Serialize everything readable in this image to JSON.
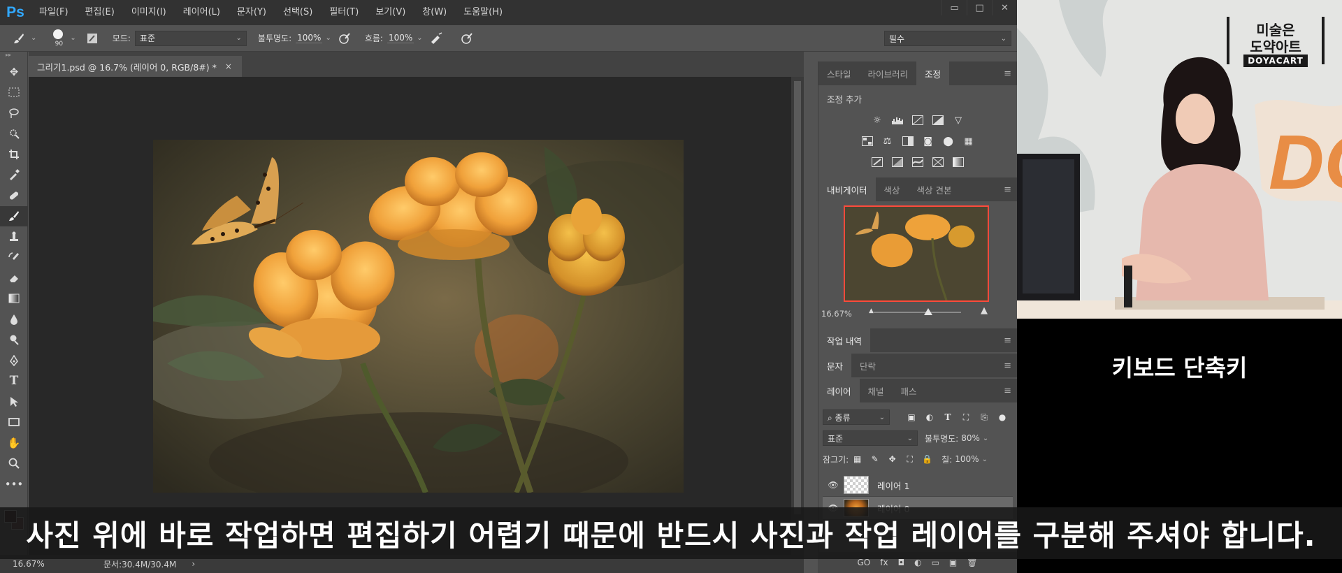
{
  "app": {
    "logo": "Ps",
    "menu": [
      "파일(F)",
      "편집(E)",
      "이미지(I)",
      "레이어(L)",
      "문자(Y)",
      "선택(S)",
      "필터(T)",
      "보기(V)",
      "창(W)",
      "도움말(H)"
    ],
    "window_controls": [
      "▭",
      "□",
      "✕"
    ]
  },
  "options": {
    "brush_size": "90",
    "mode_label": "모드:",
    "mode_value": "표준",
    "opacity_label": "불투명도:",
    "opacity_value": "100%",
    "flow_label": "흐름:",
    "flow_value": "100%",
    "workspace": "필수"
  },
  "document": {
    "tab_title": "그리기1.psd @ 16.7% (레이어 0, RGB/8#) *",
    "close": "×"
  },
  "status": {
    "zoom": "16.67%",
    "doc_size": "문서:30.4M/30.4M",
    "arrow": "›"
  },
  "panels": {
    "top_tabs": [
      "스타일",
      "라이브러리",
      "조정"
    ],
    "adjustments_title": "조정 추가",
    "navigator_tabs": [
      "내비게이터",
      "색상",
      "색상 견본"
    ],
    "navigator_zoom": "16.67%",
    "history_tab": "작업 내역",
    "type_tabs": [
      "문자",
      "단락"
    ],
    "layers_tabs": [
      "레이어",
      "채널",
      "패스"
    ],
    "filter_kind": "종류",
    "blend_mode": "표준",
    "opacity_label": "불투명도:",
    "opacity_value": "80%",
    "lock_label": "잠그기:",
    "fill_label": "칠:",
    "fill_value": "100%",
    "layers": [
      {
        "name": "레이어 1",
        "selected": false
      },
      {
        "name": "레이어 0",
        "selected": true
      }
    ],
    "footer_icons": [
      "GO",
      "fx",
      "◘",
      "◐",
      "▭",
      "▣",
      "🗑"
    ]
  },
  "overlay": {
    "brand_line1": "미술은",
    "brand_line2": "도약아트",
    "brand_sub": "DOYACART",
    "cam_caption": "키보드 단축키",
    "subtitle": "사진 위에 바로 작업하면 편집하기 어렵기 때문에 반드시 사진과 작업 레이어를 구분해 주셔야 합니다."
  },
  "colors": {
    "accent_ps": "#31a8ff",
    "navigator_frame": "#ff4a3b",
    "foreground": "#2b1414",
    "background": "#533131"
  }
}
